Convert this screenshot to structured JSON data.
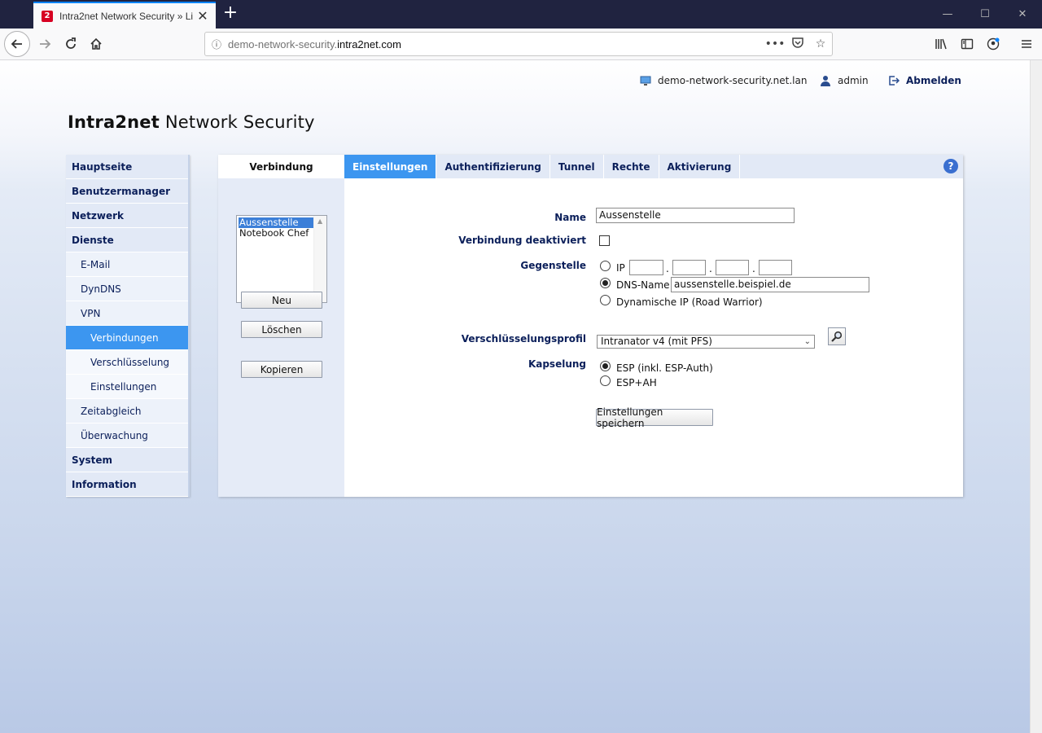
{
  "browser": {
    "tab_title": "Intra2net Network Security » Li",
    "tab_favicon": "2",
    "url_prefix": "demo-network-security.",
    "url_domain": "intra2net.com"
  },
  "header": {
    "host": "demo-network-security.net.lan",
    "user": "admin",
    "logout": "Abmelden",
    "logo_brand": "Intra2net",
    "logo_product": "Network Security"
  },
  "nav": {
    "items": [
      {
        "label": "Hauptseite",
        "level": 1
      },
      {
        "label": "Benutzermanager",
        "level": 1
      },
      {
        "label": "Netzwerk",
        "level": 1
      },
      {
        "label": "Dienste",
        "level": 1
      },
      {
        "label": "E-Mail",
        "level": 2
      },
      {
        "label": "DynDNS",
        "level": 2
      },
      {
        "label": "VPN",
        "level": 2
      },
      {
        "label": "Verbindungen",
        "level": 3,
        "active": true
      },
      {
        "label": "Verschlüsselung",
        "level": 3
      },
      {
        "label": "Einstellungen",
        "level": 3
      },
      {
        "label": "Zeitabgleich",
        "level": 2
      },
      {
        "label": "Überwachung",
        "level": 2
      },
      {
        "label": "System",
        "level": 1
      },
      {
        "label": "Information",
        "level": 1
      }
    ]
  },
  "panel": {
    "left_title": "Verbindung",
    "tabs": [
      "Einstellungen",
      "Authentifizierung",
      "Tunnel",
      "Rechte",
      "Aktivierung"
    ],
    "active_tab": "Einstellungen",
    "help": "?",
    "connections": [
      "Aussenstelle",
      "Notebook Chef"
    ],
    "selected_connection": "Aussenstelle",
    "buttons": {
      "new": "Neu",
      "delete": "Löschen",
      "copy": "Kopieren"
    }
  },
  "form": {
    "name_label": "Name",
    "name_value": "Aussenstelle",
    "disabled_label": "Verbindung deaktiviert",
    "disabled_checked": false,
    "peer_label": "Gegenstelle",
    "peer_ip_label": "IP",
    "peer_dns_label": "DNS-Name",
    "peer_dns_value": "aussenstelle.beispiel.de",
    "peer_dynamic_label": "Dynamische IP (Road Warrior)",
    "peer_selected": "DNS-Name",
    "profile_label": "Verschlüsselungsprofil",
    "profile_value": "Intranator v4 (mit PFS)",
    "encap_label": "Kapselung",
    "encap_esp": "ESP (inkl. ESP-Auth)",
    "encap_espah": "ESP+AH",
    "encap_selected": "ESP (inkl. ESP-Auth)",
    "save_label": "Einstellungen speichern"
  },
  "colors": {
    "accent": "#3c96f0",
    "nav_bg": "#e2e9f6",
    "nav_text": "#0b1f5a"
  }
}
